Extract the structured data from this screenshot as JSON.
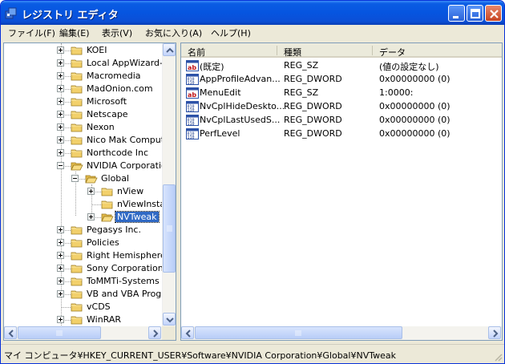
{
  "window": {
    "title": "レジストリ エディタ"
  },
  "menu": [
    "ファイル(F)",
    "編集(E)",
    "表示(V)",
    "お気に入り(A)",
    "ヘルプ(H)"
  ],
  "tree": [
    {
      "label": "KOEI",
      "level": 0,
      "exp": "plus"
    },
    {
      "label": "Local AppWizard-G",
      "level": 0,
      "exp": "plus"
    },
    {
      "label": "Macromedia",
      "level": 0,
      "exp": "plus"
    },
    {
      "label": "MadOnion.com",
      "level": 0,
      "exp": "plus"
    },
    {
      "label": "Microsoft",
      "level": 0,
      "exp": "plus"
    },
    {
      "label": "Netscape",
      "level": 0,
      "exp": "plus"
    },
    {
      "label": "Nexon",
      "level": 0,
      "exp": "plus"
    },
    {
      "label": "Nico Mak Computin",
      "level": 0,
      "exp": "plus"
    },
    {
      "label": "Northcode Inc",
      "level": 0,
      "exp": "plus"
    },
    {
      "label": "NVIDIA Corporatio",
      "level": 0,
      "exp": "minus"
    },
    {
      "label": "Global",
      "level": 1,
      "exp": "minus"
    },
    {
      "label": "nView",
      "level": 2,
      "exp": "plus"
    },
    {
      "label": "nViewInsta",
      "level": 2,
      "exp": "none"
    },
    {
      "label": "NVTweak",
      "level": 2,
      "exp": "plus",
      "selected": true
    },
    {
      "label": "Pegasys Inc.",
      "level": 0,
      "exp": "plus"
    },
    {
      "label": "Policies",
      "level": 0,
      "exp": "plus"
    },
    {
      "label": "Right Hemisphere",
      "level": 0,
      "exp": "plus"
    },
    {
      "label": "Sony Corporation",
      "level": 0,
      "exp": "plus"
    },
    {
      "label": "ToMMTi-Systems",
      "level": 0,
      "exp": "plus"
    },
    {
      "label": "VB and VBA Progr",
      "level": 0,
      "exp": "plus"
    },
    {
      "label": "vCDS",
      "level": 0,
      "exp": "none"
    },
    {
      "label": "WinRAR",
      "level": 0,
      "exp": "plus"
    }
  ],
  "columns": {
    "name": "名前",
    "type": "種類",
    "data": "データ"
  },
  "values": [
    {
      "name": "(既定)",
      "type": "REG_SZ",
      "data": "(値の設定なし)",
      "icon": "string-value-icon"
    },
    {
      "name": "AppProfileAdvan...",
      "type": "REG_DWORD",
      "data": "0x00000000 (0)",
      "icon": "binary-value-icon"
    },
    {
      "name": "MenuEdit",
      "type": "REG_SZ",
      "data": "1:0000:",
      "icon": "string-value-icon"
    },
    {
      "name": "NvCplHideDeskto...",
      "type": "REG_DWORD",
      "data": "0x00000000 (0)",
      "icon": "binary-value-icon"
    },
    {
      "name": "NvCplLastUsedS...",
      "type": "REG_DWORD",
      "data": "0x00000000 (0)",
      "icon": "binary-value-icon"
    },
    {
      "name": "PerfLevel",
      "type": "REG_DWORD",
      "data": "0x00000000 (0)",
      "icon": "binary-value-icon"
    }
  ],
  "status": {
    "path": "マイ コンピュータ¥HKEY_CURRENT_USER¥Software¥NVIDIA Corporation¥Global¥NVTweak"
  },
  "colors": {
    "titlebar": "#0a5ce3",
    "selection": "#316ac5",
    "folder": "#f2d06b"
  }
}
